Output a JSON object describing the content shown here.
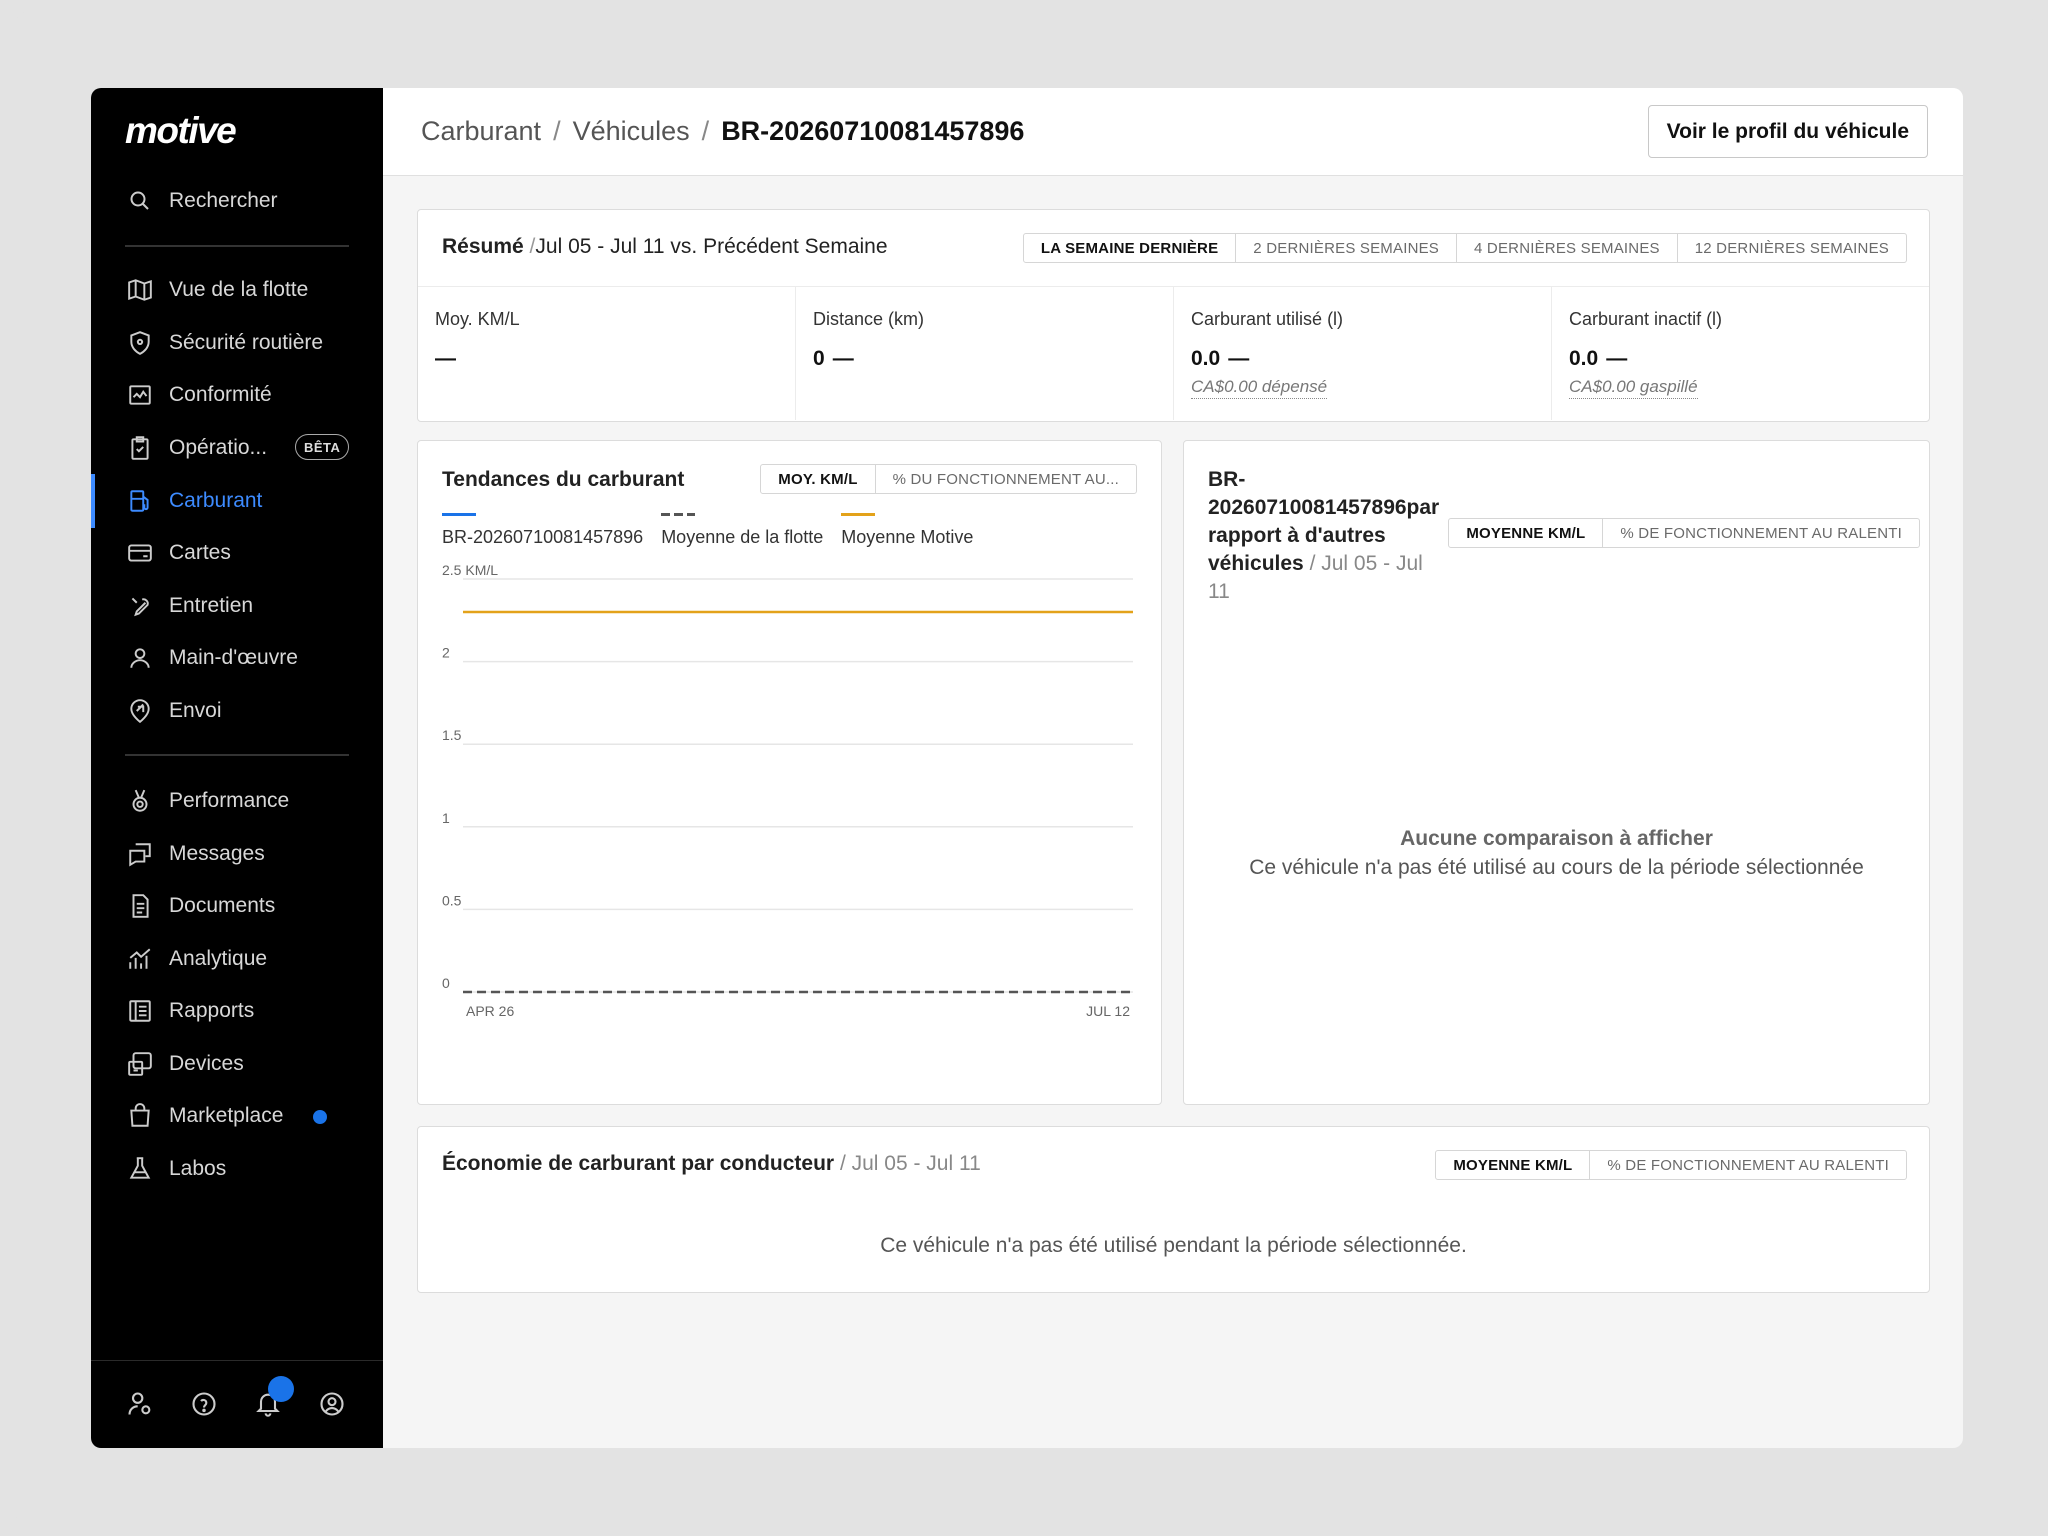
{
  "brand": {
    "logo": "motive"
  },
  "search": {
    "label": "Rechercher"
  },
  "nav": {
    "fleet_view": "Vue de la flotte",
    "road_safety": "Sécurité routière",
    "compliance": "Conformité",
    "operations": "Opératio...",
    "operations_badge": "BÊTA",
    "fuel": "Carburant",
    "cards": "Cartes",
    "maintenance": "Entretien",
    "workforce": "Main-d'œuvre",
    "dispatch": "Envoi",
    "performance": "Performance",
    "messages": "Messages",
    "documents": "Documents",
    "analytics": "Analytique",
    "reports": "Rapports",
    "devices": "Devices",
    "marketplace": "Marketplace",
    "labs": "Labos"
  },
  "breadcrumb": {
    "level1": "Carburant",
    "level2": "Véhicules",
    "current": "BR-20260710081457896"
  },
  "header": {
    "profile_button": "Voir le profil du véhicule"
  },
  "summary": {
    "title": "Résumé",
    "period": "Jul 05 - Jul 11 vs. Précédent Semaine",
    "ranges": [
      "LA SEMAINE DERNIÈRE",
      "2 DERNIÈRES SEMAINES",
      "4 DERNIÈRES SEMAINES",
      "12 DERNIÈRES SEMAINES"
    ],
    "metrics": {
      "avg_label": "Moy. KM/L",
      "avg_value": "—",
      "distance_label": "Distance (km)",
      "distance_value": "0",
      "distance_delta": "—",
      "fuel_used_label": "Carburant utilisé (l)",
      "fuel_used_value": "0.0",
      "fuel_used_delta": "—",
      "fuel_used_cost": "CA$0.00 dépensé",
      "idle_label": "Carburant inactif (l)",
      "idle_value": "0.0",
      "idle_delta": "—",
      "idle_cost": "CA$0.00 gaspillé"
    }
  },
  "trends": {
    "title": "Tendances du carburant",
    "tabs": [
      "MOY. KM/L",
      "% DU FONCTIONNEMENT AU..."
    ],
    "legend": {
      "vehicle": "BR-20260710081457896",
      "fleet": "Moyenne de la flotte",
      "motive": "Moyenne Motive"
    },
    "colors": {
      "vehicle": "#1a73e8",
      "fleet": "#555555",
      "motive": "#e3a21a"
    }
  },
  "chart_data": {
    "type": "line",
    "x": [
      "APR 26",
      "JUL 12"
    ],
    "ylim": [
      0,
      2.5
    ],
    "ytick_labels": [
      "2.5 KM/L",
      "2",
      "1.5",
      "1",
      "0.5",
      "0"
    ],
    "yticks": [
      2.5,
      2,
      1.5,
      1,
      0.5,
      0
    ],
    "series": [
      {
        "name": "Moyenne Motive",
        "values": [
          2.3,
          2.3
        ]
      },
      {
        "name": "Moyenne de la flotte",
        "values": [
          0,
          0
        ]
      }
    ]
  },
  "comparison": {
    "title_line1": "BR-",
    "title_line2": "20260710081457896par",
    "title_line3": "rapport à d'autres",
    "title_line4": "véhicules",
    "period_line1": "/ Jul 05 - Jul",
    "period_line2": "11",
    "tabs": [
      "MOYENNE KM/L",
      "% DE FONCTIONNEMENT AU RALENTI"
    ],
    "empty_title": "Aucune comparaison à afficher",
    "empty_text": "Ce véhicule n'a pas été utilisé au cours de la période sélectionnée"
  },
  "economy": {
    "title": "Économie de carburant par conducteur",
    "period": "/ Jul 05 - Jul 11",
    "tabs": [
      "MOYENNE KM/L",
      "% DE FONCTIONNEMENT AU RALENTI"
    ],
    "empty_text": "Ce véhicule n'a pas été utilisé pendant la période sélectionnée."
  }
}
